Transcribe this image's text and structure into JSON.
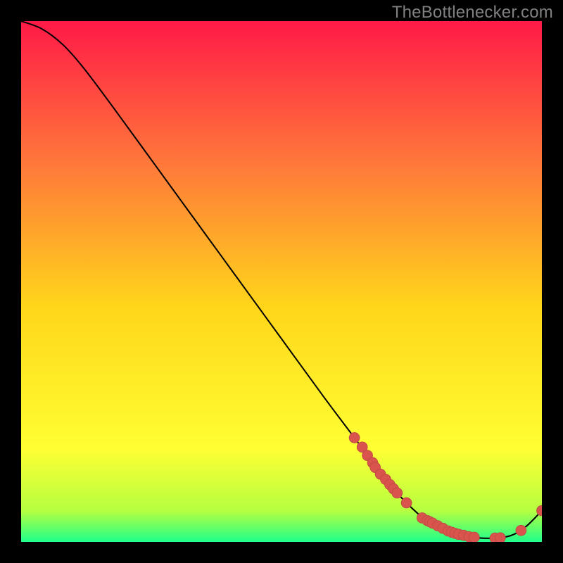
{
  "watermark": "TheBottlenecker.com",
  "colors": {
    "bg": "#000000",
    "watermark": "#808080",
    "curve": "#000000",
    "marker_fill": "#d9544d",
    "marker_stroke": "#c04a44",
    "gradient_top": "#ff1a47",
    "gradient_q1": "#ff7a3a",
    "gradient_mid": "#ffd61a",
    "gradient_q3": "#ffff33",
    "gradient_near_bottom": "#b6ff40",
    "gradient_bottom": "#1fff8a"
  },
  "chart_data": {
    "type": "line",
    "title": "",
    "xlabel": "",
    "ylabel": "",
    "xlim": [
      0,
      100
    ],
    "ylim": [
      0,
      100
    ],
    "series": [
      {
        "name": "bottleneck-curve",
        "x": [
          0,
          4,
          8,
          12,
          18,
          26,
          34,
          42,
          50,
          58,
          64,
          70,
          74,
          78,
          82,
          86,
          90,
          94,
          97,
          100
        ],
        "y": [
          100,
          98.5,
          95.5,
          91,
          83,
          72,
          61,
          50,
          39,
          28,
          20,
          12,
          7.5,
          4,
          2,
          1,
          0.7,
          1.2,
          3,
          6
        ]
      }
    ],
    "markers": {
      "name": "highlight-points",
      "x": [
        64,
        65.5,
        66.5,
        67.5,
        68,
        69,
        70,
        70.8,
        71.5,
        72.2,
        74,
        77,
        78,
        78.5,
        79,
        80,
        81,
        82,
        82.7,
        83.3,
        84,
        85,
        86,
        87,
        91,
        92,
        96,
        100
      ],
      "y": [
        20,
        18.2,
        16.6,
        15.2,
        14.3,
        13,
        12,
        11,
        10.2,
        9.4,
        7.5,
        4.6,
        4.1,
        3.85,
        3.6,
        3.1,
        2.6,
        2.1,
        1.85,
        1.65,
        1.45,
        1.25,
        1.0,
        0.88,
        0.73,
        0.78,
        2.2,
        6
      ]
    }
  }
}
